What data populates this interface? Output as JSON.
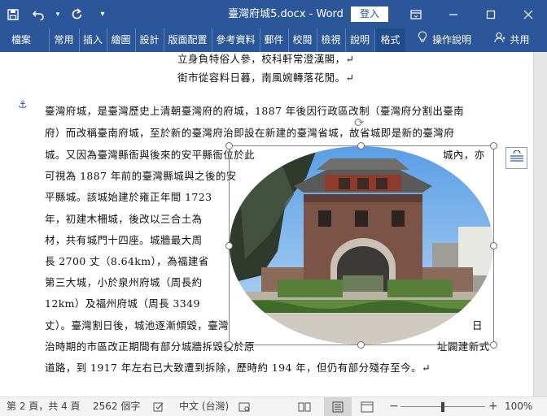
{
  "titlebar": {
    "title": "臺灣府城5.docx  -  Word",
    "login_label": "登入",
    "save_icon": "save-icon",
    "undo_icon": "undo-icon",
    "redo_icon": "redo-icon",
    "customize_icon": "customize-qat-icon"
  },
  "tabs": [
    {
      "label": "檔案"
    },
    {
      "label": "常用"
    },
    {
      "label": "插入"
    },
    {
      "label": "繪圖"
    },
    {
      "label": "設計"
    },
    {
      "label": "版面配置"
    },
    {
      "label": "參考資料"
    },
    {
      "label": "郵件"
    },
    {
      "label": "校閱"
    },
    {
      "label": "檢視"
    },
    {
      "label": "說明"
    },
    {
      "label": "格式"
    },
    {
      "label": "操作說明"
    },
    {
      "label": "共用"
    }
  ],
  "document": {
    "lines": [
      "立身負特俗人參，校科軒常澄漢閣，↵",
      "街市從容料日暮，南風婉轉落花閒。↵",
      "臺灣府城，是臺灣歷史上清朝臺灣府的府城，1887 年後因行政區改制（臺灣府分割出臺南",
      "府）而改稱臺南府城，至於新的臺灣府治即設在新建的臺灣省城，故省城即是新的臺灣府",
      "城。又因為臺灣縣衙與後來的安平縣衙位於此",
      "城內，亦",
      "可視為 1887 年前的臺灣縣城與之後的安",
      "平縣城。該城始建於雍正年間 1723",
      "年，初建木柵城，後改以三合土為",
      "材，共有城門十四座。城牆最大周",
      "長 2700 丈（8.64km），為福建省",
      "第三大城，小於泉州府城（周長約",
      "12km）及福州府城（周長 3349",
      "丈）。臺灣割日後，城池逐漸傾毀，臺灣",
      "日",
      "治時期的市區改正期間有部分城牆拆毀後於原",
      "址闢建新式",
      "道路，到 1917 年左右已大致遭到拆除，歷時約 194 年，但仍有部分殘存至今。↵"
    ]
  },
  "statusbar": {
    "page": "第 2 頁，共 4 頁",
    "words": "2562 個字",
    "language": "中文 (台灣)",
    "zoom": "100%",
    "zoom_minus": "−",
    "zoom_plus": "+"
  },
  "ribbon": {
    "tell_me_icon": "lightbulb-icon",
    "share_icon": "person-icon"
  }
}
